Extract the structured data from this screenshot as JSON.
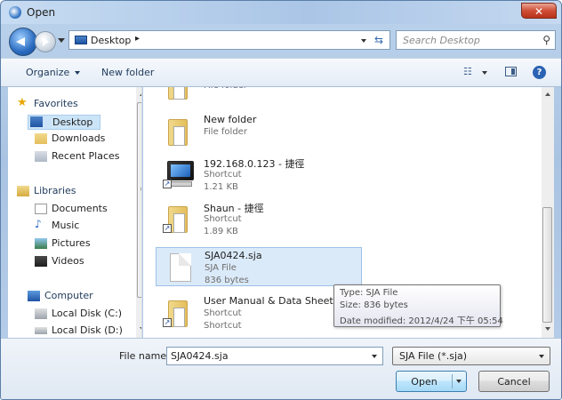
{
  "window": {
    "title": "Open"
  },
  "address": {
    "location": "Desktop",
    "separator": "▸",
    "search_placeholder": "Search Desktop"
  },
  "toolbar": {
    "organize": "Organize",
    "new_folder": "New folder"
  },
  "nav": {
    "favorites": "Favorites",
    "desktop": "Desktop",
    "downloads": "Downloads",
    "recent_places": "Recent Places",
    "libraries": "Libraries",
    "documents": "Documents",
    "music": "Music",
    "pictures": "Pictures",
    "videos": "Videos",
    "computer": "Computer",
    "local_disk_c": "Local Disk (C:)",
    "local_disk_d": "Local Disk (D:)"
  },
  "files": [
    {
      "name": "",
      "type": "File folder",
      "size": ""
    },
    {
      "name": "New folder",
      "type": "File folder",
      "size": ""
    },
    {
      "name": "192.168.0.123 - 捷徑",
      "type": "Shortcut",
      "size": "1.21 KB"
    },
    {
      "name": "Shaun - 捷徑",
      "type": "Shortcut",
      "size": "1.89 KB"
    },
    {
      "name": "SJA0424.sja",
      "type": "SJA File",
      "size": "836 bytes"
    },
    {
      "name": "User Manual & Data Sheet -",
      "type": "Shortcut",
      "size": "Shortcut"
    }
  ],
  "tooltip": {
    "type": "Type: SJA File",
    "size": "Size: 836 bytes",
    "date": "Date modified: 2012/4/24 下午 05:54"
  },
  "bottom": {
    "file_name_label": "File name:",
    "file_name_value": "SJA0424.sja",
    "file_type": "SJA File (*.sja)",
    "open": "Open",
    "cancel": "Cancel"
  },
  "colors": {
    "selection": "#dbeaf9",
    "window_frame": "#aac5e6",
    "close_button": "#cf4f37"
  },
  "icons": [
    "search-icon",
    "help-icon",
    "refresh-icon",
    "folder-icon",
    "computer-icon",
    "doc-icon"
  ]
}
